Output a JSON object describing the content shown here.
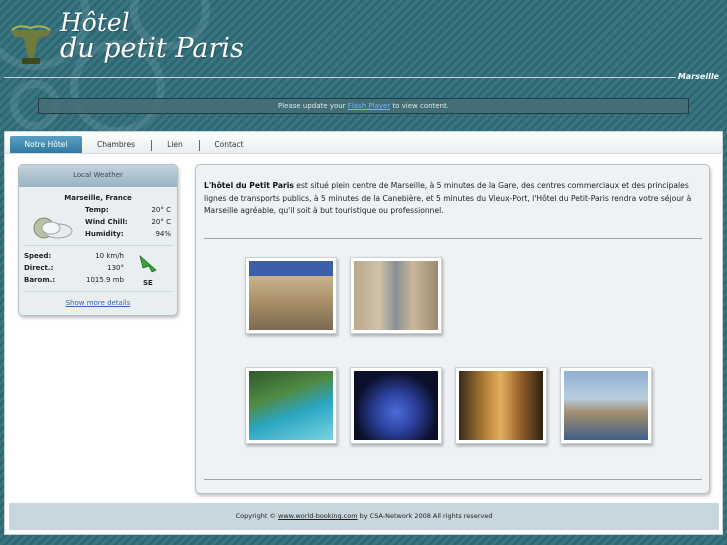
{
  "header": {
    "title_line1": "Hôtel",
    "title_line2": "du petit Paris",
    "city": "Marseille"
  },
  "flash": {
    "prefix": "Please update your",
    "link": "Flash Player",
    "suffix": "to view content."
  },
  "nav": {
    "items": [
      {
        "label": "Notre Hôtel",
        "active": true
      },
      {
        "label": "Chambres"
      },
      {
        "label": "Lien"
      },
      {
        "label": "Contact"
      }
    ]
  },
  "weather": {
    "heading": "Local Weather",
    "location": "Marseille, France",
    "temp_label": "Temp:",
    "temp_value": "20° C",
    "windchill_label": "Wind Chill:",
    "windchill_value": "20° C",
    "humidity_label": "Humidity:",
    "humidity_value": "94%",
    "speed_label": "Speed:",
    "speed_value": "10 km/h",
    "direct_label": "Direct.:",
    "direct_value": "130°",
    "barom_label": "Barom.:",
    "barom_value": "1015.9 mb",
    "wind_dir": "SE",
    "more_link": "Show more details",
    "icons": [
      "cloudy-moon-icon",
      "wind-arrow-icon"
    ]
  },
  "content": {
    "intro_bold": "L'hôtel du Petit Paris",
    "intro_text": " est situé plein centre de Marseille, à 5 minutes de la Gare, des centres commerciaux et des principales lignes de transports publics, à 5 minutes de la Canebière, et 5 minutes du Vieux-Port, l'Hôtel du Petit-Paris rendra votre séjour à Marseille agréable, qu'il soit à but touristique ou professionnel."
  },
  "footer": {
    "prefix": "Copyright ©",
    "link": "www.world-booking.com",
    "suffix": "by CSA-Network 2008 All rights reserved"
  },
  "colors": {
    "background": "#2f6a76",
    "nav_active": "#3a86ad",
    "link": "#3567b0",
    "footer_bg": "#c8d6de"
  }
}
